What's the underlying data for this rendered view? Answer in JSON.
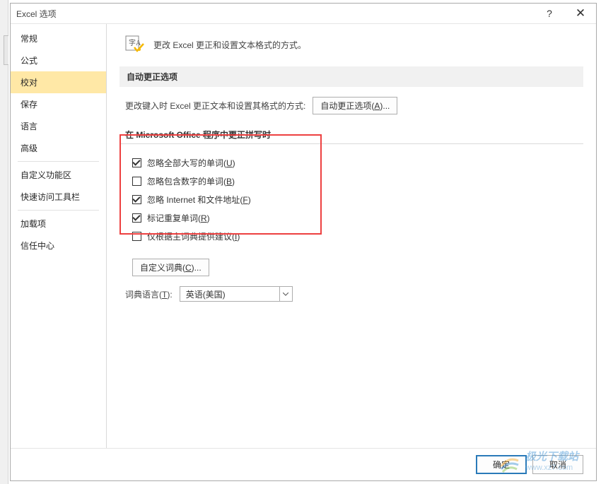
{
  "titlebar": {
    "title": "Excel 选项",
    "help_glyph": "?",
    "close_glyph": "✕"
  },
  "sidebar": {
    "items": [
      {
        "label": "常规",
        "selected": false
      },
      {
        "label": "公式",
        "selected": false
      },
      {
        "label": "校对",
        "selected": true
      },
      {
        "label": "保存",
        "selected": false
      },
      {
        "label": "语言",
        "selected": false
      },
      {
        "label": "高级",
        "selected": false
      }
    ],
    "items2": [
      {
        "label": "自定义功能区"
      },
      {
        "label": "快速访问工具栏"
      }
    ],
    "items3": [
      {
        "label": "加载项"
      },
      {
        "label": "信任中心"
      }
    ]
  },
  "header": {
    "text": "更改 Excel 更正和设置文本格式的方式。"
  },
  "section_autocorrect": {
    "title": "自动更正选项",
    "label": "更改键入时 Excel 更正文本和设置其格式的方式:",
    "button": "自动更正选项(A)..."
  },
  "section_spelling": {
    "title": "在 Microsoft Office 程序中更正拼写时",
    "checks": [
      {
        "label_pre": "忽略全部大写的单词(",
        "accel": "U",
        "label_post": ")",
        "checked": true
      },
      {
        "label_pre": "忽略包含数字的单词(",
        "accel": "B",
        "label_post": ")",
        "checked": false
      },
      {
        "label_pre": "忽略 Internet 和文件地址(",
        "accel": "F",
        "label_post": ")",
        "checked": true
      },
      {
        "label_pre": "标记重复单词(",
        "accel": "R",
        "label_post": ")",
        "checked": true
      },
      {
        "label_pre": "仅根据主词典提供建议(",
        "accel": "I",
        "label_post": ")",
        "checked": false
      }
    ],
    "custom_dict_button": "自定义词典(C)...",
    "lang_label": "词典语言(T):",
    "lang_value": "英语(美国)"
  },
  "footer": {
    "ok": "确定",
    "cancel": "取消"
  },
  "watermark": {
    "line1": "极光下载站",
    "line2": "www.xz7.com"
  }
}
